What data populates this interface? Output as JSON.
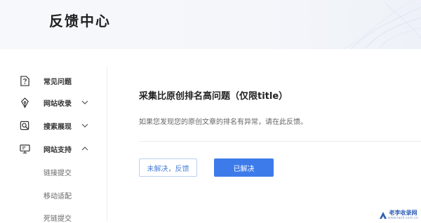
{
  "header": {
    "title": "反馈中心"
  },
  "sidebar": {
    "items": [
      {
        "label": "常见问题",
        "icon": "question-doc-icon",
        "has_chevron": false
      },
      {
        "label": "网站收录",
        "icon": "pen-nib-icon",
        "has_chevron": true,
        "chevron": "down"
      },
      {
        "label": "搜索展现",
        "icon": "magnifier-icon",
        "has_chevron": true,
        "chevron": "down"
      },
      {
        "label": "网站支持",
        "icon": "monitor-icon",
        "has_chevron": true,
        "chevron": "up"
      }
    ],
    "subitems": [
      "链接提交",
      "移动适配",
      "死链提交"
    ]
  },
  "main": {
    "title": "采集比原创排名高问题（仅限title）",
    "description": "如果您发现您的原创文章的排名有异常，请在此反馈。",
    "buttons": {
      "unsolved": "未解决，反馈",
      "solved": "已解决"
    }
  },
  "watermark": {
    "text": "老李收录网",
    "subtext": "www.laoli.com.cn"
  },
  "colors": {
    "accent": "#3d7bea",
    "accent_text": "#4a7fd6",
    "header_bg": "#f4f6fa",
    "divider": "#ececec"
  }
}
